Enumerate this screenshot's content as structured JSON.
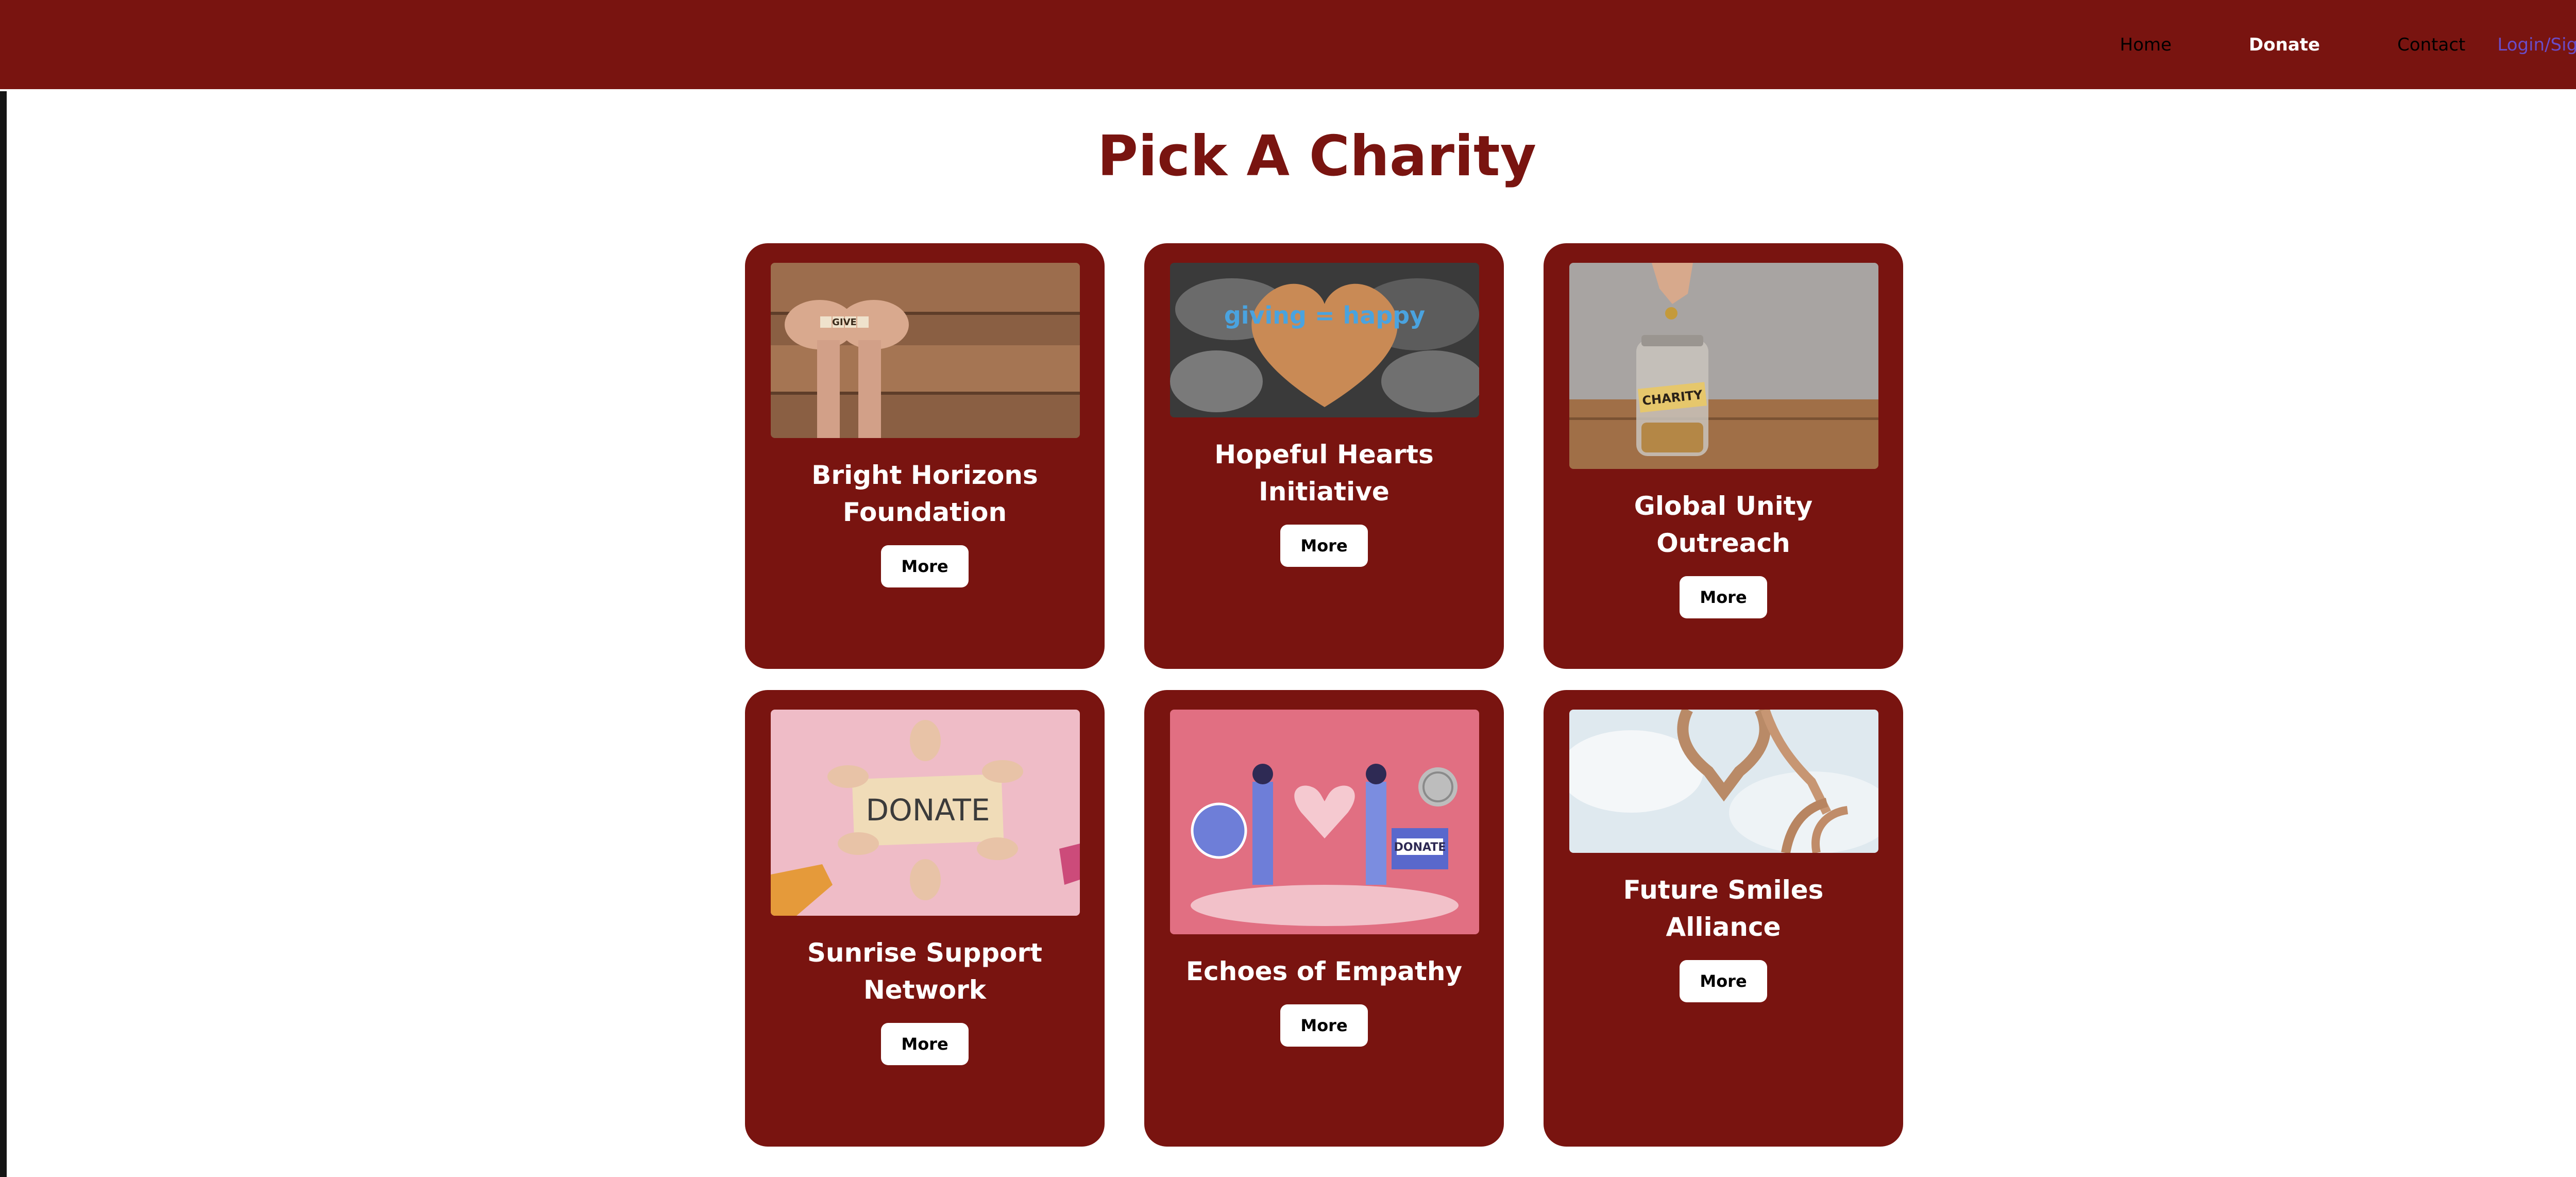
{
  "nav": {
    "home": "Home",
    "donate": "Donate",
    "contact": "Contact",
    "login": "Login/Sign Up"
  },
  "page_title": "Pick A Charity",
  "charities": [
    {
      "name": "Bright Horizons Foundation",
      "button": "More",
      "image_text": "GIVE"
    },
    {
      "name": "Hopeful Hearts Initiative",
      "button": "More",
      "image_text": "giving = happy"
    },
    {
      "name": "Global Unity Outreach",
      "button": "More",
      "image_text": "CHARITY"
    },
    {
      "name": "Sunrise Support Network",
      "button": "More",
      "image_text": "DONATE"
    },
    {
      "name": "Echoes of Empathy",
      "button": "More",
      "image_text": "DONATE"
    },
    {
      "name": "Future Smiles Alliance",
      "button": "More",
      "image_text": ""
    }
  ],
  "colors": {
    "brand": "#791410",
    "login_link": "#6a4cc7",
    "button_bg": "#ffffff"
  }
}
